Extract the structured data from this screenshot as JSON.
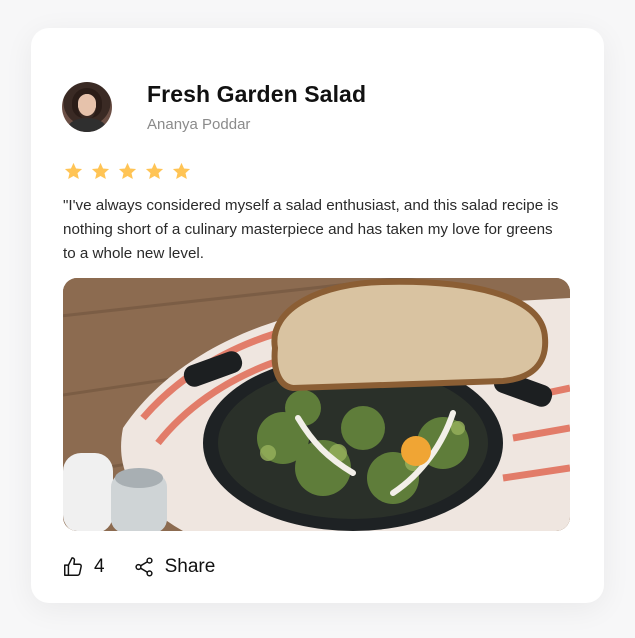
{
  "post": {
    "title": "Fresh Garden Salad",
    "author": "Ananya Poddar",
    "rating": 5,
    "rating_max": 5,
    "star_color": "#FFC455",
    "review": "\"I've always considered myself a salad enthusiast, and this salad recipe is nothing short of a culinary masterpiece and has taken my love for greens to a whole new level."
  },
  "actions": {
    "like_icon": "thumbs-up-icon",
    "like_count": "4",
    "share_icon": "share-icon",
    "share_label": "Share"
  }
}
